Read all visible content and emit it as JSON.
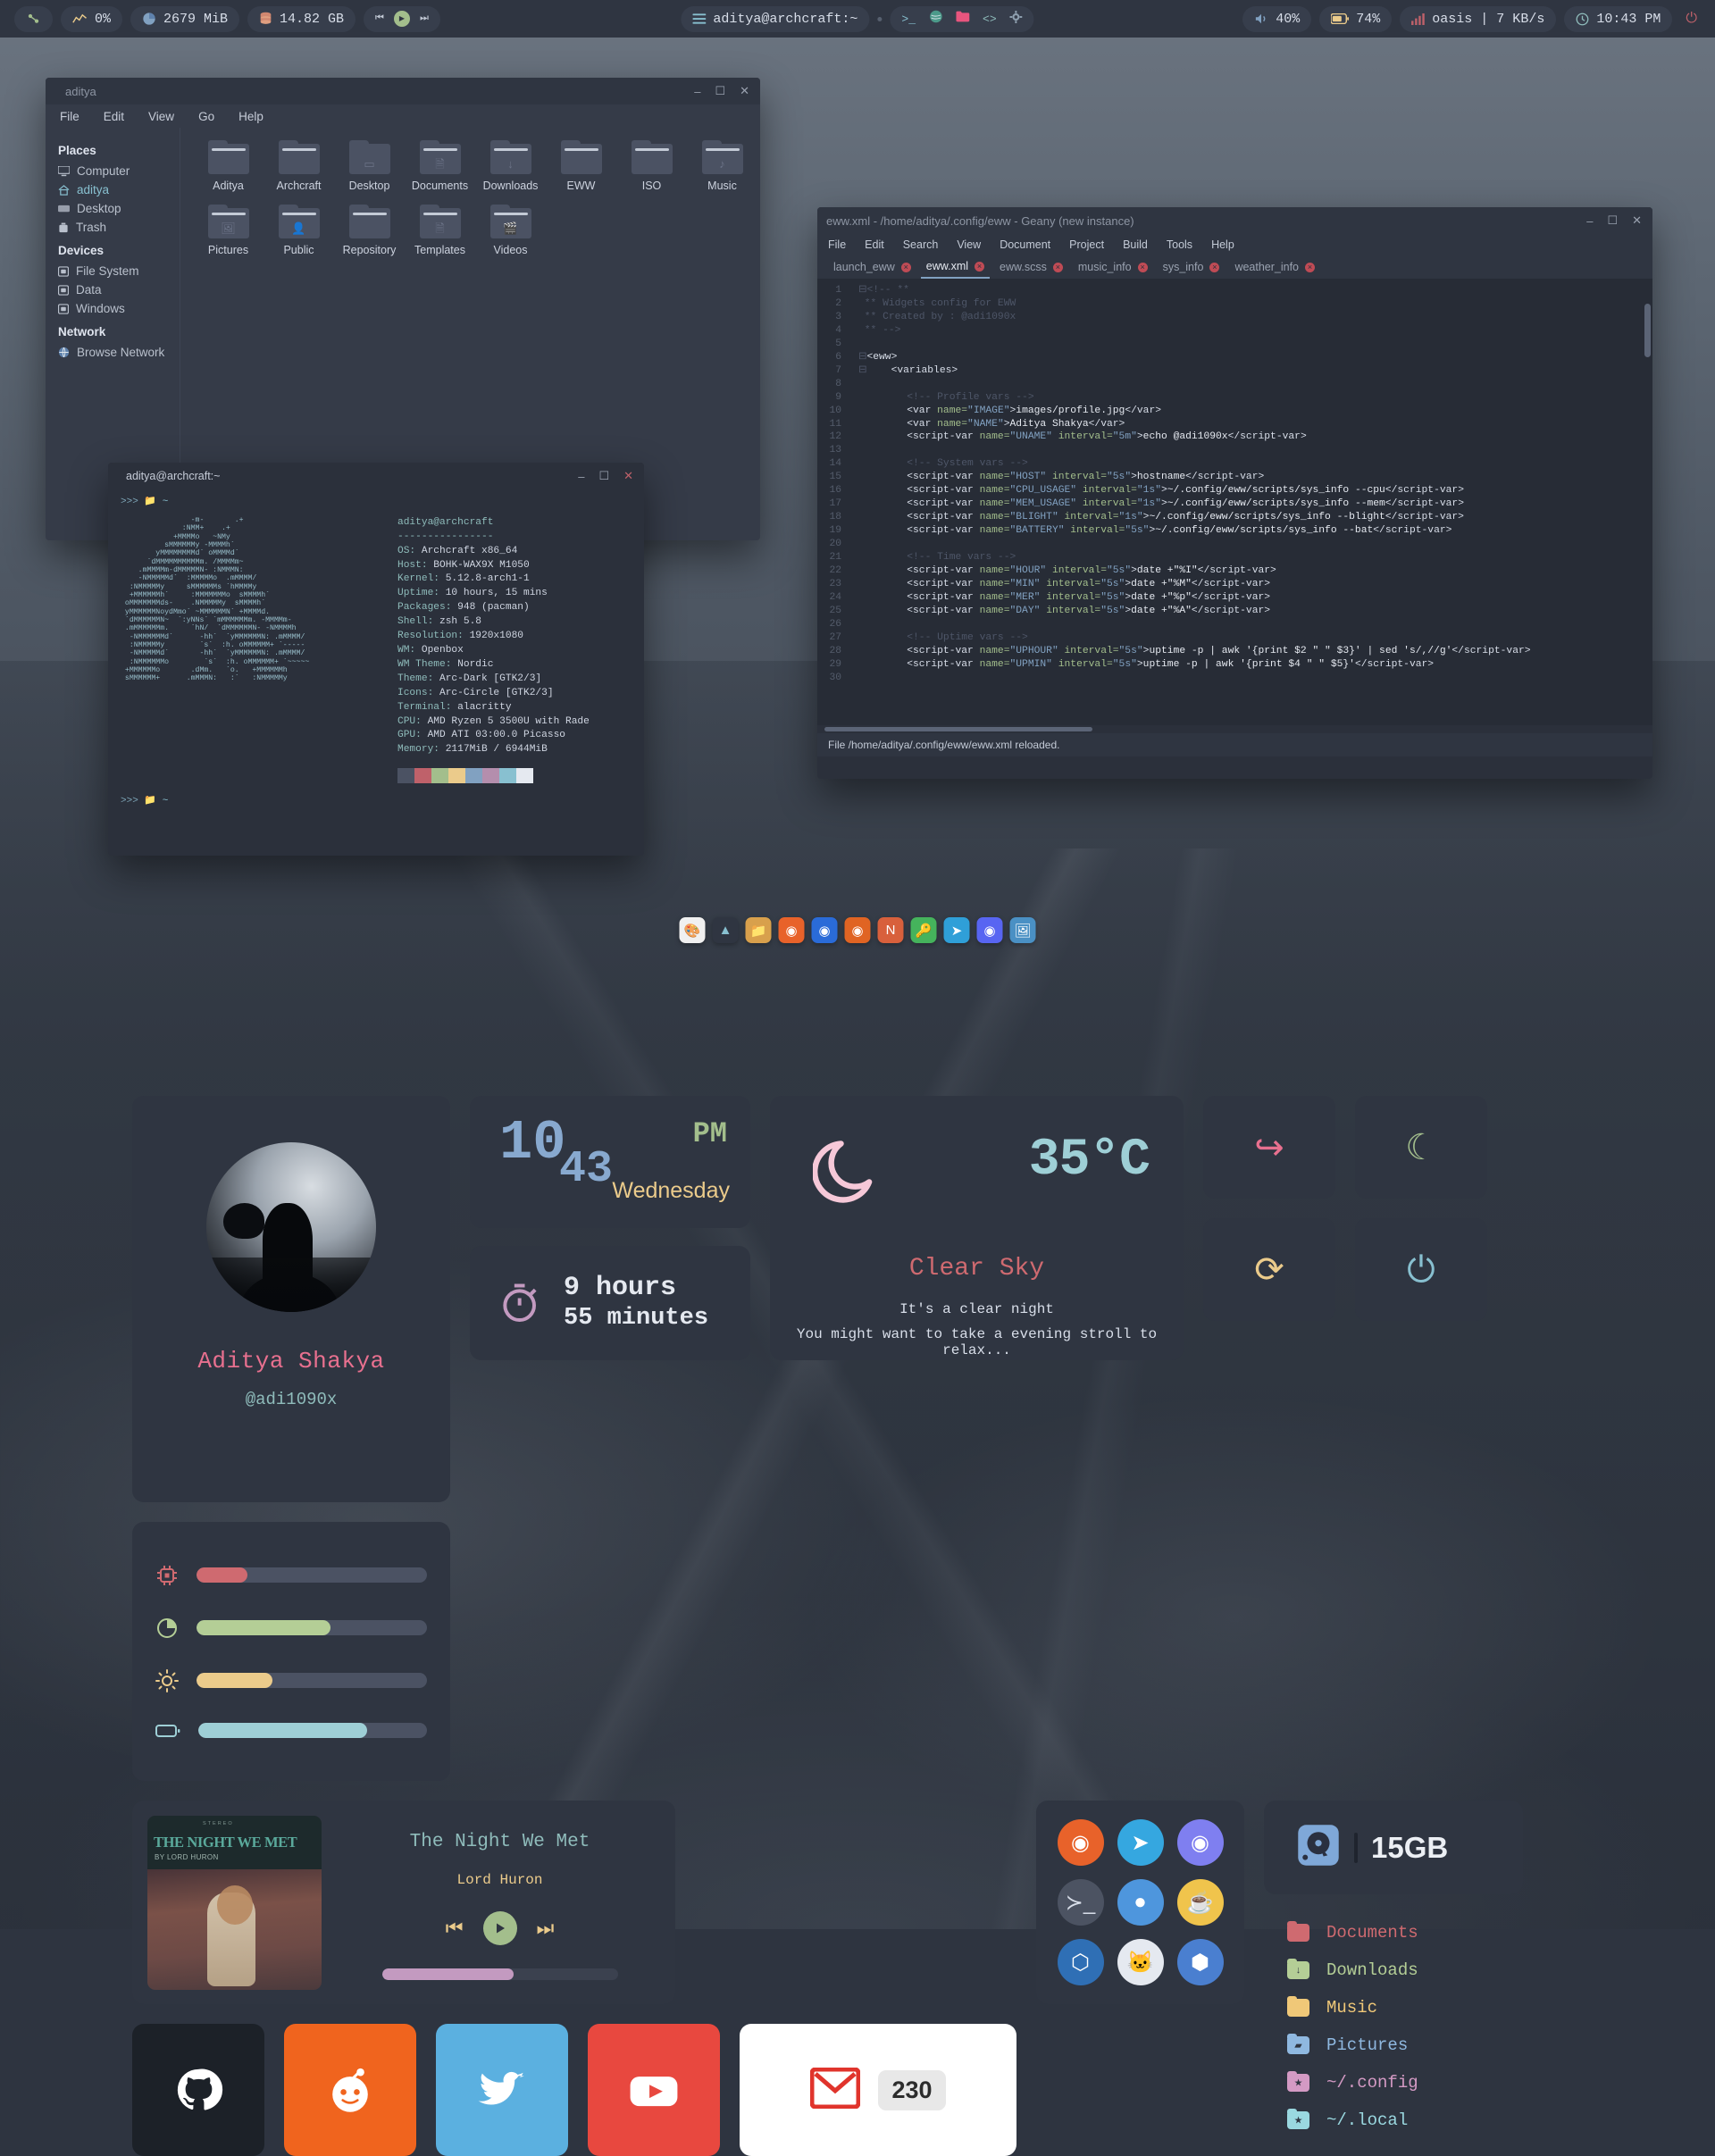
{
  "topbar": {
    "left": [
      {
        "name": "arch-logo",
        "label": ""
      },
      {
        "name": "cpu",
        "label": "0%"
      },
      {
        "name": "memory",
        "label": "2679 MiB"
      },
      {
        "name": "disk",
        "label": "14.82 GB"
      }
    ],
    "media": {
      "prev": "⏮",
      "play": "▶",
      "next": "⏭"
    },
    "window_title": "aditya@archcraft:~",
    "launchers": [
      "terminal-icon",
      "browser-icon",
      "files-icon",
      "code-icon",
      "settings-icon"
    ],
    "right": [
      {
        "name": "volume",
        "label": "40%"
      },
      {
        "name": "battery",
        "label": "74%"
      },
      {
        "name": "network",
        "label": "oasis | 7 KB/s"
      },
      {
        "name": "clock",
        "label": "10:43 PM"
      }
    ],
    "power_label": "⏻"
  },
  "filemanager": {
    "title": "aditya",
    "menu": [
      "File",
      "Edit",
      "View",
      "Go",
      "Help"
    ],
    "groups": [
      {
        "header": "Places",
        "items": [
          {
            "label": "Computer",
            "icon": "computer-icon",
            "selected": false
          },
          {
            "label": "aditya",
            "icon": "home-icon",
            "selected": true
          },
          {
            "label": "Desktop",
            "icon": "desktop-icon",
            "selected": false
          },
          {
            "label": "Trash",
            "icon": "trash-icon",
            "selected": false
          }
        ]
      },
      {
        "header": "Devices",
        "items": [
          {
            "label": "File System",
            "icon": "drive-icon",
            "selected": false
          },
          {
            "label": "Data",
            "icon": "drive-icon",
            "selected": false
          },
          {
            "label": "Windows",
            "icon": "drive-icon",
            "selected": false
          }
        ]
      },
      {
        "header": "Network",
        "items": [
          {
            "label": "Browse Network",
            "icon": "network-icon",
            "selected": false
          }
        ]
      }
    ],
    "folders": [
      {
        "label": "Aditya",
        "glyph": ""
      },
      {
        "label": "Archcraft",
        "glyph": ""
      },
      {
        "label": "Desktop",
        "glyph": "desktop"
      },
      {
        "label": "Documents",
        "glyph": "🗎"
      },
      {
        "label": "Downloads",
        "glyph": "↓"
      },
      {
        "label": "EWW",
        "glyph": ""
      },
      {
        "label": "ISO",
        "glyph": ""
      },
      {
        "label": "Music",
        "glyph": "♪"
      },
      {
        "label": "Pictures",
        "glyph": "🖼"
      },
      {
        "label": "Public",
        "glyph": "👤"
      },
      {
        "label": "Repository",
        "glyph": ""
      },
      {
        "label": "Templates",
        "glyph": "🗎"
      },
      {
        "label": "Videos",
        "glyph": "🎬"
      }
    ]
  },
  "terminal": {
    "title": "aditya@archcraft:~",
    "prompt": ">>>",
    "command": "neofetch",
    "prompt2": ">>>",
    "path2": "~",
    "path1": "~",
    "user_host": "aditya@archcraft",
    "divider": "----------------",
    "info": [
      {
        "key": "OS",
        "value": "Archcraft x86_64"
      },
      {
        "key": "Host",
        "value": "BOHK-WAX9X M1050"
      },
      {
        "key": "Kernel",
        "value": "5.12.8-arch1-1"
      },
      {
        "key": "Uptime",
        "value": "10 hours, 15 mins"
      },
      {
        "key": "Packages",
        "value": "948 (pacman)"
      },
      {
        "key": "Shell",
        "value": "zsh 5.8"
      },
      {
        "key": "Resolution",
        "value": "1920x1080"
      },
      {
        "key": "WM",
        "value": "Openbox"
      },
      {
        "key": "WM Theme",
        "value": "Nordic"
      },
      {
        "key": "Theme",
        "value": "Arc-Dark [GTK2/3]"
      },
      {
        "key": "Icons",
        "value": "Arc-Circle [GTK2/3]"
      },
      {
        "key": "Terminal",
        "value": "alacritty"
      },
      {
        "key": "CPU",
        "value": "AMD Ryzen 5 3500U with Rade"
      },
      {
        "key": "GPU",
        "value": "AMD ATI 03:00.0 Picasso"
      },
      {
        "key": "Memory",
        "value": "2117MiB / 6944MiB"
      }
    ],
    "ascii": "                -m-       .+\n              :NMM+    .+\n            +MMMMo   ~NMy\n          sMMMMMMy -MMMMh`\n        yMMMMMMMMd` oMMMMd`\n      `dMMMMMMMMMMm. /MMMMm~\n    .mMMMMm-dMMMMMN- :NMMMN:\n    -NMMMMMd`  :MMMMMo  .mMMMM/\n  :NMMMMMy     sMMMMMMs `hMMMMy\n  +MMMMMMh`     :MMMMMMMo  sMMMMh`\n oMMMMMMMds-    .NMMMMMy  sMMMMh`\n yMMMMMMNoydMmo` ~MMMMMMN` +MMMMd.\n `dMMMMMMN~  `:yNNs` `mMMMMMMm. -MMMMm-\n .mMMMMMMm.     `hN/  `dMMMMMMN- -NMMMMh\n  -NMMMMMMd`      -hh`  `yMMMMMMN: .mMMMM/\n  :NMMMMMy        `s`  :h. oMMMMMM+ `-----\n  -NMMMMMd`       -hh`  `yMMMMMMN: .mMMMM/\n  :NMMMMMMo        `s`  :h. oMMMMMM+ `~~~~~\n +MMMMMMo       .dMm.   `o.   +MMMMMMh\n sMMMMMM+      .mMMMN:   :`   :NMMMMMy",
    "colors": [
      "#4b5263",
      "#bf616a",
      "#a3be8c",
      "#ebcb8b",
      "#81a1c1",
      "#b48ead",
      "#88c0d0",
      "#e5e9f0"
    ]
  },
  "geany": {
    "title": "eww.xml - /home/aditya/.config/eww - Geany (new instance)",
    "menu": [
      "File",
      "Edit",
      "Search",
      "View",
      "Document",
      "Project",
      "Build",
      "Tools",
      "Help"
    ],
    "tabs": [
      {
        "label": "launch_eww",
        "active": false
      },
      {
        "label": "eww.xml",
        "active": true
      },
      {
        "label": "eww.scss",
        "active": false
      },
      {
        "label": "music_info",
        "active": false
      },
      {
        "label": "sys_info",
        "active": false
      },
      {
        "label": "weather_info",
        "active": false
      }
    ],
    "status": "File /home/aditya/.config/eww/eww.xml reloaded.",
    "lines": [
      {
        "n": 1,
        "html": "<span class='c-fold'>⊟</span><span class='c-com'>&lt;!-- **</span>"
      },
      {
        "n": 2,
        "html": " <span class='c-com'>** Widgets config for EWW</span>"
      },
      {
        "n": 3,
        "html": " <span class='c-com'>** Created by : @adi1090x</span>"
      },
      {
        "n": 4,
        "html": " <span class='c-com'>** --&gt;</span>"
      },
      {
        "n": 5,
        "html": ""
      },
      {
        "n": 6,
        "html": "<span class='c-fold'>⊟</span><span class='c-tag'>&lt;eww&gt;</span>"
      },
      {
        "n": 7,
        "html": "<span class='c-fold'>⊟</span>    <span class='c-tag'>&lt;variables&gt;</span>"
      },
      {
        "n": 8,
        "html": ""
      },
      {
        "n": 9,
        "html": "        <span class='c-com'>&lt;!-- Profile vars --&gt;</span>"
      },
      {
        "n": 10,
        "html": "        <span class='c-tag'>&lt;var</span> <span class='c-atr'>name=</span><span class='c-str'>\"IMAGE\"</span><span class='c-tag'>&gt;</span><span class='c-txt'>images/profile.jpg</span><span class='c-tag'>&lt;/var&gt;</span>"
      },
      {
        "n": 11,
        "html": "        <span class='c-tag'>&lt;var</span> <span class='c-atr'>name=</span><span class='c-str'>\"NAME\"</span><span class='c-tag'>&gt;</span><span class='c-txt'>Aditya Shakya</span><span class='c-tag'>&lt;/var&gt;</span>"
      },
      {
        "n": 12,
        "html": "        <span class='c-tag'>&lt;script-var</span> <span class='c-atr'>name=</span><span class='c-str'>\"UNAME\"</span> <span class='c-atr'>interval=</span><span class='c-str'>\"5m\"</span><span class='c-tag'>&gt;</span><span class='c-txt'>echo @adi1090x</span><span class='c-tag'>&lt;/script-var&gt;</span>"
      },
      {
        "n": 13,
        "html": ""
      },
      {
        "n": 14,
        "html": "        <span class='c-com'>&lt;!-- System vars --&gt;</span>"
      },
      {
        "n": 15,
        "html": "        <span class='c-tag'>&lt;script-var</span> <span class='c-atr'>name=</span><span class='c-str'>\"HOST\"</span> <span class='c-atr'>interval=</span><span class='c-str'>\"5s\"</span><span class='c-tag'>&gt;</span><span class='c-txt'>hostname</span><span class='c-tag'>&lt;/script-var&gt;</span>"
      },
      {
        "n": 16,
        "html": "        <span class='c-tag'>&lt;script-var</span> <span class='c-atr'>name=</span><span class='c-str'>\"CPU_USAGE\"</span> <span class='c-atr'>interval=</span><span class='c-str'>\"1s\"</span><span class='c-tag'>&gt;</span><span class='c-txt'>~/.config/eww/scripts/sys_info --cpu</span><span class='c-tag'>&lt;/script-var&gt;</span>"
      },
      {
        "n": 17,
        "html": "        <span class='c-tag'>&lt;script-var</span> <span class='c-atr'>name=</span><span class='c-str'>\"MEM_USAGE\"</span> <span class='c-atr'>interval=</span><span class='c-str'>\"1s\"</span><span class='c-tag'>&gt;</span><span class='c-txt'>~/.config/eww/scripts/sys_info --mem</span><span class='c-tag'>&lt;/script-var&gt;</span>"
      },
      {
        "n": 18,
        "html": "        <span class='c-tag'>&lt;script-var</span> <span class='c-atr'>name=</span><span class='c-str'>\"BLIGHT\"</span> <span class='c-atr'>interval=</span><span class='c-str'>\"1s\"</span><span class='c-tag'>&gt;</span><span class='c-txt'>~/.config/eww/scripts/sys_info --blight</span><span class='c-tag'>&lt;/script-var&gt;</span>"
      },
      {
        "n": 19,
        "html": "        <span class='c-tag'>&lt;script-var</span> <span class='c-atr'>name=</span><span class='c-str'>\"BATTERY\"</span> <span class='c-atr'>interval=</span><span class='c-str'>\"5s\"</span><span class='c-tag'>&gt;</span><span class='c-txt'>~/.config/eww/scripts/sys_info --bat</span><span class='c-tag'>&lt;/script-var&gt;</span>"
      },
      {
        "n": 20,
        "html": ""
      },
      {
        "n": 21,
        "html": "        <span class='c-com'>&lt;!-- Time vars --&gt;</span>"
      },
      {
        "n": 22,
        "html": "        <span class='c-tag'>&lt;script-var</span> <span class='c-atr'>name=</span><span class='c-str'>\"HOUR\"</span> <span class='c-atr'>interval=</span><span class='c-str'>\"5s\"</span><span class='c-tag'>&gt;</span><span class='c-txt'>date +\"%I\"</span><span class='c-tag'>&lt;/script-var&gt;</span>"
      },
      {
        "n": 23,
        "html": "        <span class='c-tag'>&lt;script-var</span> <span class='c-atr'>name=</span><span class='c-str'>\"MIN\"</span> <span class='c-atr'>interval=</span><span class='c-str'>\"5s\"</span><span class='c-tag'>&gt;</span><span class='c-txt'>date +\"%M\"</span><span class='c-tag'>&lt;/script-var&gt;</span>"
      },
      {
        "n": 24,
        "html": "        <span class='c-tag'>&lt;script-var</span> <span class='c-atr'>name=</span><span class='c-str'>\"MER\"</span> <span class='c-atr'>interval=</span><span class='c-str'>\"5s\"</span><span class='c-tag'>&gt;</span><span class='c-txt'>date +\"%p\"</span><span class='c-tag'>&lt;/script-var&gt;</span>"
      },
      {
        "n": 25,
        "html": "        <span class='c-tag'>&lt;script-var</span> <span class='c-atr'>name=</span><span class='c-str'>\"DAY\"</span> <span class='c-atr'>interval=</span><span class='c-str'>\"5s\"</span><span class='c-tag'>&gt;</span><span class='c-txt'>date +\"%A\"</span><span class='c-tag'>&lt;/script-var&gt;</span>"
      },
      {
        "n": 26,
        "html": ""
      },
      {
        "n": 27,
        "html": "        <span class='c-com'>&lt;!-- Uptime vars --&gt;</span>"
      },
      {
        "n": 28,
        "html": "        <span class='c-tag'>&lt;script-var</span> <span class='c-atr'>name=</span><span class='c-str'>\"UPHOUR\"</span> <span class='c-atr'>interval=</span><span class='c-str'>\"5s\"</span><span class='c-tag'>&gt;</span><span class='c-txt'>uptime -p | awk '{print $2 \" \" $3}' | sed 's/,//g'</span><span class='c-tag'>&lt;/script-var&gt;</span>"
      },
      {
        "n": 29,
        "html": "        <span class='c-tag'>&lt;script-var</span> <span class='c-atr'>name=</span><span class='c-str'>\"UPMIN\"</span> <span class='c-atr'>interval=</span><span class='c-str'>\"5s\"</span><span class='c-tag'>&gt;</span><span class='c-txt'>uptime -p | awk '{print $4 \" \" $5}'</span><span class='c-tag'>&lt;/script-var&gt;</span>"
      },
      {
        "n": 30,
        "html": ""
      }
    ]
  },
  "dock": [
    {
      "name": "pamac-icon",
      "bg": "#f0f0f0",
      "glyph": "🎨"
    },
    {
      "name": "archcraft-icon",
      "bg": "#2f3541",
      "glyph": "▲"
    },
    {
      "name": "files-icon",
      "bg": "#d8a04c",
      "glyph": "📁"
    },
    {
      "name": "brave-icon",
      "bg": "#e8622a",
      "glyph": "◉"
    },
    {
      "name": "firefox-dev-icon",
      "bg": "#2a6bd8",
      "glyph": "◉"
    },
    {
      "name": "firefox-icon",
      "bg": "#e06423",
      "glyph": "◉"
    },
    {
      "name": "nordpass-icon",
      "bg": "#d8603c",
      "glyph": "N"
    },
    {
      "name": "keys-icon",
      "bg": "#45b35c",
      "glyph": "🔑"
    },
    {
      "name": "telegram-icon",
      "bg": "#2f9fd8",
      "glyph": "➤"
    },
    {
      "name": "discord-icon",
      "bg": "#5865f2",
      "glyph": "◉"
    },
    {
      "name": "gallery-icon",
      "bg": "#4a90c4",
      "glyph": "🖼"
    }
  ],
  "eww": {
    "profile": {
      "name": "Aditya Shakya",
      "handle": "@adi1090x"
    },
    "clock": {
      "hour": "10",
      "min": "43",
      "meridiem": "PM",
      "day": "Wednesday"
    },
    "uptime": {
      "hours": "9 hours",
      "minutes": "55 minutes"
    },
    "weather": {
      "temp": "35°C",
      "condition": "Clear Sky",
      "subtitle": "It's a clear night",
      "hint": "You might want to take a evening stroll to relax..."
    },
    "actions": [
      {
        "name": "logout-button",
        "glyph": "↪",
        "color": "#e8708f"
      },
      {
        "name": "sleep-button",
        "glyph": "☾",
        "color": "#a3be8c"
      },
      {
        "name": "reboot-button",
        "glyph": "⟳",
        "color": "#ebcb8b"
      },
      {
        "name": "power-button",
        "glyph": "⏻",
        "color": "#88c0d0"
      }
    ],
    "sliders": [
      {
        "name": "cpu-slider",
        "icon": "cpu-icon",
        "color": "#cf6a70",
        "pct": 22
      },
      {
        "name": "memory-slider",
        "icon": "memory-icon",
        "color": "#b4ce96",
        "pct": 58
      },
      {
        "name": "brightness-slider",
        "icon": "brightness-icon",
        "color": "#ebcb8b",
        "pct": 33
      },
      {
        "name": "battery-slider",
        "icon": "battery-icon",
        "color": "#9ecfd6",
        "pct": 74
      }
    ],
    "music": {
      "title": "The Night We Met",
      "artist": "Lord Huron",
      "album_title": "THE NIGHT WE MET",
      "album_by": "BY LORD HURON",
      "album_stereo": "STEREO",
      "progress": 56,
      "prev": "⏮",
      "play": "▶",
      "next": "⏭"
    },
    "apps": [
      {
        "name": "firefox-icon",
        "bg": "#e8622a",
        "glyph": "◉",
        "fg": "#fff"
      },
      {
        "name": "telegram-icon",
        "bg": "#35a7e0",
        "glyph": "➤",
        "fg": "#fff"
      },
      {
        "name": "discord-icon",
        "bg": "#7f7ff0",
        "glyph": "◉",
        "fg": "#fff"
      },
      {
        "name": "terminal-icon",
        "bg": "#4c5362",
        "glyph": "≻_",
        "fg": "#d8dee9"
      },
      {
        "name": "files-icon",
        "bg": "#4e96dd",
        "glyph": "●",
        "fg": "#fff"
      },
      {
        "name": "tea-icon",
        "bg": "#f0c44c",
        "glyph": "☕",
        "fg": "#7a4a20"
      },
      {
        "name": "vscode-icon",
        "bg": "#2f6fb5",
        "glyph": "⬡",
        "fg": "#fff"
      },
      {
        "name": "gitkraken-icon",
        "bg": "#e5e9f0",
        "glyph": "🐱",
        "fg": "#2f3541"
      },
      {
        "name": "virtualbox-icon",
        "bg": "#4a7fd0",
        "glyph": "⬢",
        "fg": "#fff"
      }
    ],
    "disk": {
      "value": "15GB",
      "icon": "hard-drive-icon"
    },
    "bookmarks": [
      {
        "label": "Documents",
        "color": "#cf6a70",
        "glyph": ""
      },
      {
        "label": "Downloads",
        "color": "#b4ce96",
        "glyph": "↓"
      },
      {
        "label": "Music",
        "color": "#f0c878",
        "glyph": ""
      },
      {
        "label": "Pictures",
        "color": "#8fb8e0",
        "glyph": "▰"
      },
      {
        "label": "~/.config",
        "color": "#d49ac4",
        "glyph": "★"
      },
      {
        "label": "~/.local",
        "color": "#9ad8e0",
        "glyph": "★"
      }
    ],
    "social": [
      {
        "name": "github-tile",
        "bg": "#1c2128",
        "glyph": "●",
        "fg": "#fff"
      },
      {
        "name": "reddit-tile",
        "bg": "#f0641e",
        "glyph": "●",
        "fg": "#fff"
      },
      {
        "name": "twitter-tile",
        "bg": "#5bb0e0",
        "glyph": "●",
        "fg": "#fff"
      },
      {
        "name": "youtube-tile",
        "bg": "#e8483f",
        "glyph": "▶",
        "fg": "#fff"
      }
    ],
    "gmail": {
      "count": "230",
      "label": "M"
    }
  }
}
